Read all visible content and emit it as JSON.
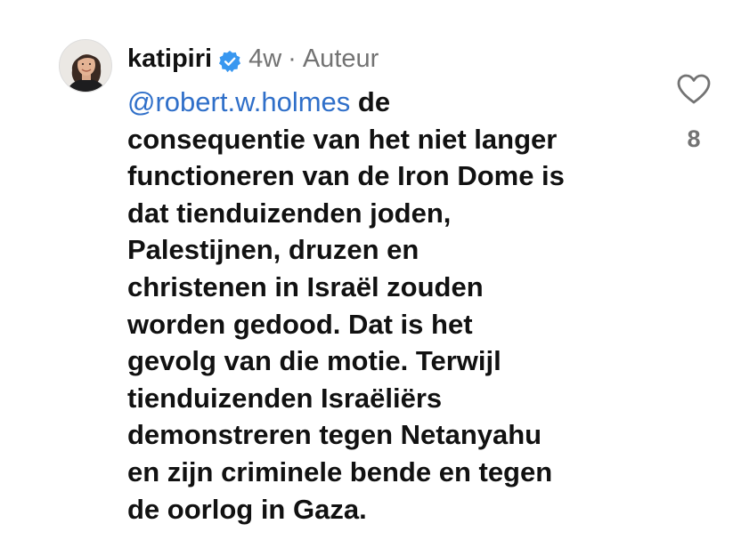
{
  "comment": {
    "avatar_icon": "profile-photo-avatar",
    "username": "katipiri",
    "verified_icon": "verified-badge-icon",
    "verified_color": "#3897f0",
    "time_ago": "4w",
    "separator": "·",
    "role_label": "Auteur",
    "mention": "@robert.w.holmes",
    "text_lines": [
      " de",
      "consequentie van het niet langer",
      "functioneren van de Iron Dome is",
      "dat tienduizenden joden,",
      "Palestijnen, druzen en",
      "christenen in Israël zouden",
      "worden gedood. Dat is het",
      "gevolg van die motie. Terwijl",
      "tienduizenden Israëliërs",
      "demonstreren tegen Netanyahu",
      "en zijn criminele bende en tegen",
      "de oorlog in Gaza."
    ],
    "like_icon": "heart-outline-icon",
    "like_count": "8",
    "colors": {
      "text": "#111111",
      "muted": "#737373",
      "mention": "#2f6fc9"
    }
  }
}
